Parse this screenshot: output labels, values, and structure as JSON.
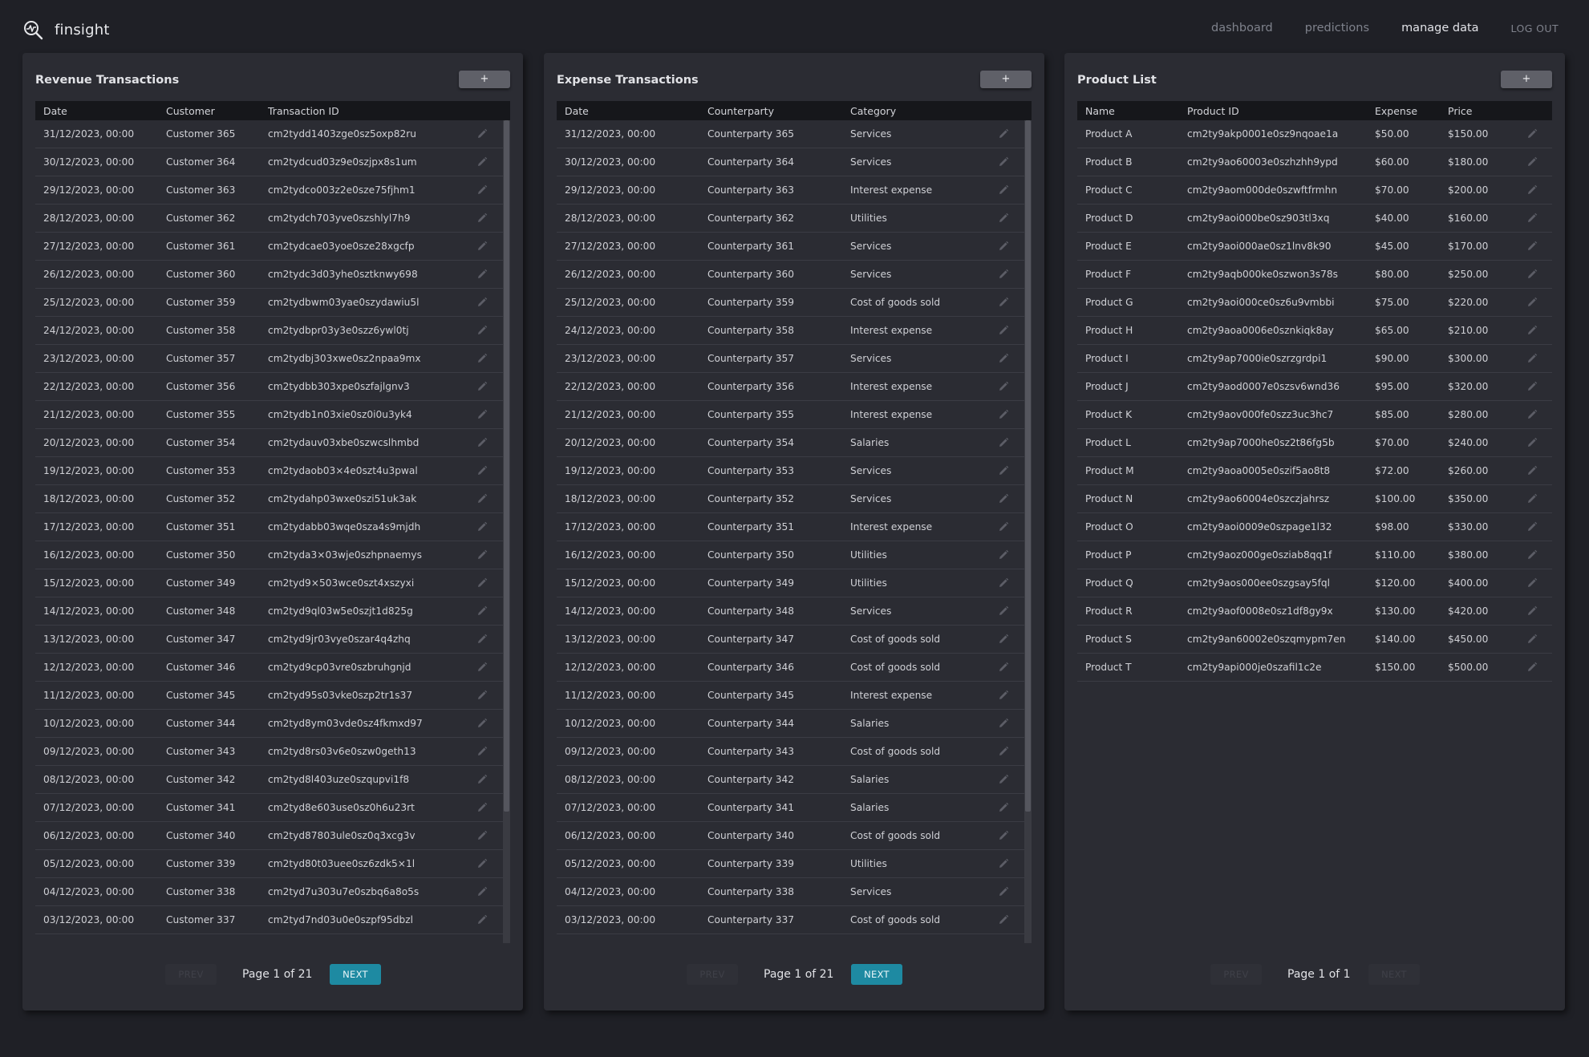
{
  "app": {
    "name": "finsight",
    "nav": [
      "dashboard",
      "predictions",
      "manage data"
    ],
    "active_nav": "manage data",
    "logout": "LOG OUT"
  },
  "revenue": {
    "title": "Revenue Transactions",
    "add_label": "+",
    "columns": [
      "Date",
      "Customer",
      "Transaction ID"
    ],
    "rows": [
      [
        "31/12/2023, 00:00",
        "Customer 365",
        "cm2tydd1403zge0sz5oxp82ru"
      ],
      [
        "30/12/2023, 00:00",
        "Customer 364",
        "cm2tydcud03z9e0szjpx8s1um"
      ],
      [
        "29/12/2023, 00:00",
        "Customer 363",
        "cm2tydco003z2e0sze75fjhm1"
      ],
      [
        "28/12/2023, 00:00",
        "Customer 362",
        "cm2tydch703yve0szshlyl7h9"
      ],
      [
        "27/12/2023, 00:00",
        "Customer 361",
        "cm2tydcae03yoe0sze28xgcfp"
      ],
      [
        "26/12/2023, 00:00",
        "Customer 360",
        "cm2tydc3d03yhe0sztknwy698"
      ],
      [
        "25/12/2023, 00:00",
        "Customer 359",
        "cm2tydbwm03yae0szydawiu5l"
      ],
      [
        "24/12/2023, 00:00",
        "Customer 358",
        "cm2tydbpr03y3e0szz6ywl0tj"
      ],
      [
        "23/12/2023, 00:00",
        "Customer 357",
        "cm2tydbj303xwe0sz2npaa9mx"
      ],
      [
        "22/12/2023, 00:00",
        "Customer 356",
        "cm2tydbb303xpe0szfajlgnv3"
      ],
      [
        "21/12/2023, 00:00",
        "Customer 355",
        "cm2tydb1n03xie0sz0i0u3yk4"
      ],
      [
        "20/12/2023, 00:00",
        "Customer 354",
        "cm2tydauv03xbe0szwcslhmbd"
      ],
      [
        "19/12/2023, 00:00",
        "Customer 353",
        "cm2tydaob03×4e0szt4u3pwal"
      ],
      [
        "18/12/2023, 00:00",
        "Customer 352",
        "cm2tydahp03wxe0szi51uk3ak"
      ],
      [
        "17/12/2023, 00:00",
        "Customer 351",
        "cm2tydabb03wqe0sza4s9mjdh"
      ],
      [
        "16/12/2023, 00:00",
        "Customer 350",
        "cm2tyda3×03wje0szhpnaemys"
      ],
      [
        "15/12/2023, 00:00",
        "Customer 349",
        "cm2tyd9×503wce0szt4xszyxi"
      ],
      [
        "14/12/2023, 00:00",
        "Customer 348",
        "cm2tyd9ql03w5e0szjt1d825g"
      ],
      [
        "13/12/2023, 00:00",
        "Customer 347",
        "cm2tyd9jr03vye0szar4q4zhq"
      ],
      [
        "12/12/2023, 00:00",
        "Customer 346",
        "cm2tyd9cp03vre0szbruhgnjd"
      ],
      [
        "11/12/2023, 00:00",
        "Customer 345",
        "cm2tyd95s03vke0szp2tr1s37"
      ],
      [
        "10/12/2023, 00:00",
        "Customer 344",
        "cm2tyd8ym03vde0sz4fkmxd97"
      ],
      [
        "09/12/2023, 00:00",
        "Customer 343",
        "cm2tyd8rs03v6e0szw0geth13"
      ],
      [
        "08/12/2023, 00:00",
        "Customer 342",
        "cm2tyd8l403uze0szqupvi1f8"
      ],
      [
        "07/12/2023, 00:00",
        "Customer 341",
        "cm2tyd8e603use0sz0h6u23rt"
      ],
      [
        "06/12/2023, 00:00",
        "Customer 340",
        "cm2tyd87803ule0sz0q3xcg3v"
      ],
      [
        "05/12/2023, 00:00",
        "Customer 339",
        "cm2tyd80t03uee0sz6zdk5×1l"
      ],
      [
        "04/12/2023, 00:00",
        "Customer 338",
        "cm2tyd7u303u7e0szbq6a8o5s"
      ],
      [
        "03/12/2023, 00:00",
        "Customer 337",
        "cm2tyd7nd03u0e0szpf95dbzl"
      ]
    ],
    "pager": {
      "prev": "PREV",
      "label": "Page 1 of 21",
      "next": "NEXT",
      "next_enabled": true
    }
  },
  "expense": {
    "title": "Expense Transactions",
    "add_label": "+",
    "columns": [
      "Date",
      "Counterparty",
      "Category"
    ],
    "rows": [
      [
        "31/12/2023, 00:00",
        "Counterparty 365",
        "Services"
      ],
      [
        "30/12/2023, 00:00",
        "Counterparty 364",
        "Services"
      ],
      [
        "29/12/2023, 00:00",
        "Counterparty 363",
        "Interest expense"
      ],
      [
        "28/12/2023, 00:00",
        "Counterparty 362",
        "Utilities"
      ],
      [
        "27/12/2023, 00:00",
        "Counterparty 361",
        "Services"
      ],
      [
        "26/12/2023, 00:00",
        "Counterparty 360",
        "Services"
      ],
      [
        "25/12/2023, 00:00",
        "Counterparty 359",
        "Cost of goods sold"
      ],
      [
        "24/12/2023, 00:00",
        "Counterparty 358",
        "Interest expense"
      ],
      [
        "23/12/2023, 00:00",
        "Counterparty 357",
        "Services"
      ],
      [
        "22/12/2023, 00:00",
        "Counterparty 356",
        "Interest expense"
      ],
      [
        "21/12/2023, 00:00",
        "Counterparty 355",
        "Interest expense"
      ],
      [
        "20/12/2023, 00:00",
        "Counterparty 354",
        "Salaries"
      ],
      [
        "19/12/2023, 00:00",
        "Counterparty 353",
        "Services"
      ],
      [
        "18/12/2023, 00:00",
        "Counterparty 352",
        "Services"
      ],
      [
        "17/12/2023, 00:00",
        "Counterparty 351",
        "Interest expense"
      ],
      [
        "16/12/2023, 00:00",
        "Counterparty 350",
        "Utilities"
      ],
      [
        "15/12/2023, 00:00",
        "Counterparty 349",
        "Utilities"
      ],
      [
        "14/12/2023, 00:00",
        "Counterparty 348",
        "Services"
      ],
      [
        "13/12/2023, 00:00",
        "Counterparty 347",
        "Cost of goods sold"
      ],
      [
        "12/12/2023, 00:00",
        "Counterparty 346",
        "Cost of goods sold"
      ],
      [
        "11/12/2023, 00:00",
        "Counterparty 345",
        "Interest expense"
      ],
      [
        "10/12/2023, 00:00",
        "Counterparty 344",
        "Salaries"
      ],
      [
        "09/12/2023, 00:00",
        "Counterparty 343",
        "Cost of goods sold"
      ],
      [
        "08/12/2023, 00:00",
        "Counterparty 342",
        "Salaries"
      ],
      [
        "07/12/2023, 00:00",
        "Counterparty 341",
        "Salaries"
      ],
      [
        "06/12/2023, 00:00",
        "Counterparty 340",
        "Cost of goods sold"
      ],
      [
        "05/12/2023, 00:00",
        "Counterparty 339",
        "Utilities"
      ],
      [
        "04/12/2023, 00:00",
        "Counterparty 338",
        "Services"
      ],
      [
        "03/12/2023, 00:00",
        "Counterparty 337",
        "Cost of goods sold"
      ]
    ],
    "pager": {
      "prev": "PREV",
      "label": "Page 1 of 21",
      "next": "NEXT",
      "next_enabled": true
    }
  },
  "products": {
    "title": "Product List",
    "add_label": "+",
    "columns": [
      "Name",
      "Product ID",
      "Expense",
      "Price"
    ],
    "rows": [
      [
        "Product A",
        "cm2ty9akp0001e0sz9nqoae1a",
        "$50.00",
        "$150.00"
      ],
      [
        "Product B",
        "cm2ty9ao60003e0szhzhh9ypd",
        "$60.00",
        "$180.00"
      ],
      [
        "Product C",
        "cm2ty9aom000de0szwftfrmhn",
        "$70.00",
        "$200.00"
      ],
      [
        "Product D",
        "cm2ty9aoi000be0sz903tl3xq",
        "$40.00",
        "$160.00"
      ],
      [
        "Product E",
        "cm2ty9aoi000ae0sz1lnv8k90",
        "$45.00",
        "$170.00"
      ],
      [
        "Product F",
        "cm2ty9aqb000ke0szwon3s78s",
        "$80.00",
        "$250.00"
      ],
      [
        "Product G",
        "cm2ty9aoi000ce0sz6u9vmbbi",
        "$75.00",
        "$220.00"
      ],
      [
        "Product H",
        "cm2ty9aoa0006e0sznkiqk8ay",
        "$65.00",
        "$210.00"
      ],
      [
        "Product I",
        "cm2ty9ap7000ie0szrzgrdpi1",
        "$90.00",
        "$300.00"
      ],
      [
        "Product J",
        "cm2ty9aod0007e0szsv6wnd36",
        "$95.00",
        "$320.00"
      ],
      [
        "Product K",
        "cm2ty9aov000fe0szz3uc3hc7",
        "$85.00",
        "$280.00"
      ],
      [
        "Product L",
        "cm2ty9ap7000he0sz2t86fg5b",
        "$70.00",
        "$240.00"
      ],
      [
        "Product M",
        "cm2ty9aoa0005e0szif5ao8t8",
        "$72.00",
        "$260.00"
      ],
      [
        "Product N",
        "cm2ty9ao60004e0szczjahrsz",
        "$100.00",
        "$350.00"
      ],
      [
        "Product O",
        "cm2ty9aoi0009e0szpage1l32",
        "$98.00",
        "$330.00"
      ],
      [
        "Product P",
        "cm2ty9aoz000ge0sziab8qq1f",
        "$110.00",
        "$380.00"
      ],
      [
        "Product Q",
        "cm2ty9aos000ee0szgsay5fql",
        "$120.00",
        "$400.00"
      ],
      [
        "Product R",
        "cm2ty9aof0008e0sz1df8gy9x",
        "$130.00",
        "$420.00"
      ],
      [
        "Product S",
        "cm2ty9an60002e0szqmypm7en",
        "$140.00",
        "$450.00"
      ],
      [
        "Product T",
        "cm2ty9api000je0szafil1c2e",
        "$150.00",
        "$500.00"
      ]
    ],
    "pager": {
      "prev": "PREV",
      "label": "Page 1 of 1",
      "next": "NEXT",
      "next_enabled": false
    }
  },
  "colors": {
    "background": "#1f2026",
    "panel": "#2b2c33",
    "header_row": "#16171b",
    "next_button": "#1e8aa2"
  },
  "icons": [
    "finsight-logo-icon",
    "edit-pencil-icon"
  ]
}
